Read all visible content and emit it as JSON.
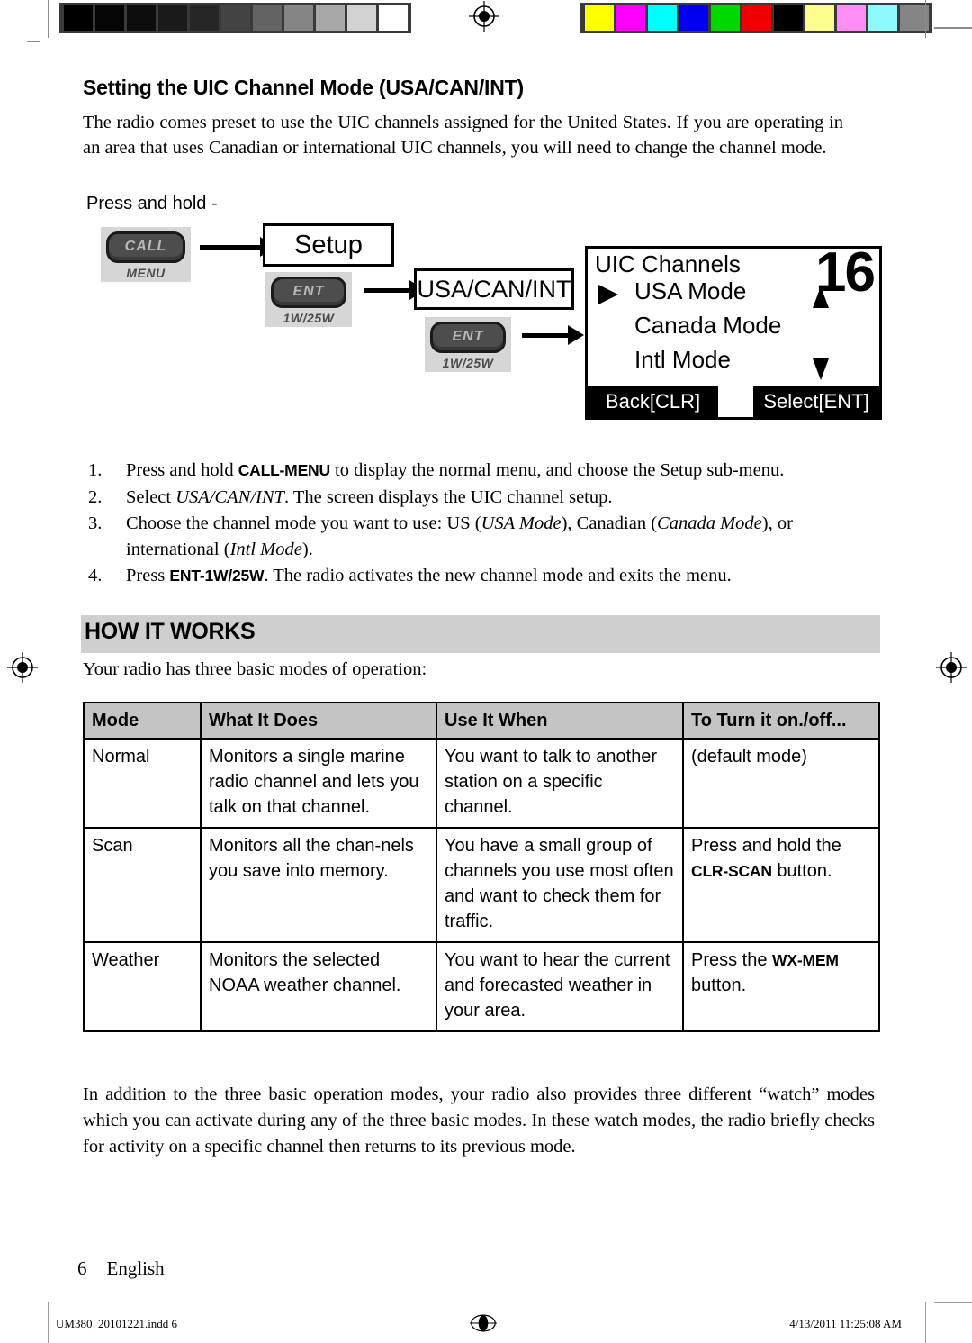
{
  "document": {
    "section_title": "Setting the UIC Channel Mode (USA/CAN/INT)",
    "intro_paragraph": "The radio comes preset to use the UIC channels assigned for the United States. If you are operating in an area that uses Canadian or international UIC channels, you will need to change the channel mode.",
    "press_and_hold_label": "Press and hold -"
  },
  "diagram": {
    "call_key": {
      "cap": "CALL",
      "sub": "MENU"
    },
    "ent_key_1": {
      "cap": "ENT",
      "sub": "1W/25W"
    },
    "ent_key_2": {
      "cap": "ENT",
      "sub": "1W/25W"
    },
    "box_setup": "Setup",
    "box_usa_can_int": "USA/CAN/INT",
    "lcd": {
      "header": "UIC Channels",
      "items": [
        {
          "label": "USA Mode",
          "selected": true
        },
        {
          "label": "Canada Mode",
          "selected": false
        },
        {
          "label": "Intl Mode",
          "selected": false
        }
      ],
      "channel_number": "16",
      "softkey_left": "Back[CLR]",
      "softkey_right": "Select[ENT]",
      "scroll_up_icon": "triangle-up-icon",
      "scroll_down_icon": "triangle-down-icon",
      "selection_icon": "triangle-right-icon"
    }
  },
  "steps": [
    {
      "num": "1.",
      "parts": [
        {
          "t": "Press and hold ",
          "s": "plain"
        },
        {
          "t": "CALL-MENU",
          "s": "kbd"
        },
        {
          "t": " to display the normal menu, and choose the Setup sub-menu.",
          "s": "plain"
        }
      ]
    },
    {
      "num": "2.",
      "parts": [
        {
          "t": "Select ",
          "s": "plain"
        },
        {
          "t": "USA/CAN/INT",
          "s": "ital"
        },
        {
          "t": ". The screen displays the UIC channel setup.",
          "s": "plain"
        }
      ]
    },
    {
      "num": "3.",
      "parts": [
        {
          "t": "Choose the channel mode you want to use: US (",
          "s": "plain"
        },
        {
          "t": "USA Mode",
          "s": "ital"
        },
        {
          "t": "), Canadian (",
          "s": "plain"
        },
        {
          "t": "Canada Mode",
          "s": "ital"
        },
        {
          "t": "), or international (",
          "s": "plain"
        },
        {
          "t": "Intl Mode",
          "s": "ital"
        },
        {
          "t": ").",
          "s": "plain"
        }
      ]
    },
    {
      "num": "4.",
      "parts": [
        {
          "t": "Press ",
          "s": "plain"
        },
        {
          "t": "ENT-1W/25W",
          "s": "kbd"
        },
        {
          "t": ". The radio activates the new channel mode and exits the menu.",
          "s": "plain"
        }
      ]
    }
  ],
  "how_it_works": {
    "heading": "HOW IT WORKS",
    "intro": "Your radio has three basic modes of operation:",
    "table": {
      "headers": [
        "Mode",
        "What It Does",
        "Use It When",
        "To Turn it on./off..."
      ],
      "rows": [
        {
          "mode": "Normal",
          "what_it_does": "Monitors a single marine radio channel and lets you talk on that channel.",
          "use_it_when": "You want to talk to another station on a specific channel.",
          "turn_on_off_parts": [
            {
              "t": "(default mode)",
              "s": "plain"
            }
          ]
        },
        {
          "mode": "Scan",
          "what_it_does": "Monitors all the chan-nels you save into memory.",
          "use_it_when": "You have a small group of channels you use most often and want to check them for traffic.",
          "turn_on_off_parts": [
            {
              "t": "Press and hold the ",
              "s": "plain"
            },
            {
              "t": "CLR-SCAN",
              "s": "kbd"
            },
            {
              "t": " button.",
              "s": "plain"
            }
          ]
        },
        {
          "mode": "Weather",
          "what_it_does": "Monitors the selected NOAA weather channel.",
          "use_it_when": "You want to hear the current and forecasted weather in your area.",
          "turn_on_off_parts": [
            {
              "t": "Press the ",
              "s": "plain"
            },
            {
              "t": "WX-MEM",
              "s": "kbd"
            },
            {
              "t": " button.",
              "s": "plain"
            }
          ]
        }
      ]
    },
    "closing_paragraph": "In addition to the three basic operation modes, your radio also provides three different “watch” modes which you can activate during any of the three basic modes. In these watch modes, the radio briefly checks for activity on a specific channel then returns to its previous mode."
  },
  "footer": {
    "page_number": "6",
    "language": "English",
    "print_file": "UM380_20101221.indd   6",
    "print_timestamp": "4/13/2011   11:25:08 AM"
  },
  "calibration": {
    "gray_swatches": [
      "#000000",
      "#050505",
      "#0d0d0d",
      "#1a1a1a",
      "#262626",
      "#434343",
      "#636363",
      "#858585",
      "#a8a8a8",
      "#d2d2d2",
      "#ffffff"
    ],
    "color_swatches": [
      "#ffff00",
      "#ff00ff",
      "#00ffff",
      "#0000ee",
      "#00d900",
      "#ee0000",
      "#000000",
      "#fdfd8e",
      "#ff8ef5",
      "#8efaff",
      "#858585"
    ]
  }
}
